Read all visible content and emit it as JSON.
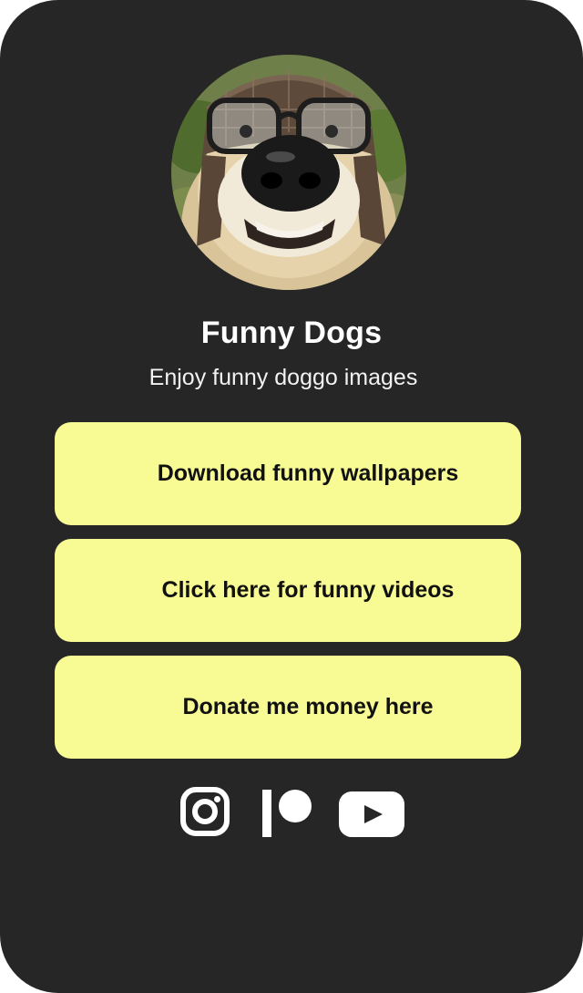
{
  "profile": {
    "name": "Funny Dogs",
    "tagline": "Enjoy funny doggo images",
    "avatar_icon": "dog-with-glasses-photo"
  },
  "links": [
    {
      "label": "Download funny wallpapers"
    },
    {
      "label": "Click here for funny videos"
    },
    {
      "label": "Donate me money here"
    }
  ],
  "socials": [
    {
      "icon": "instagram-icon"
    },
    {
      "icon": "patreon-icon"
    },
    {
      "icon": "youtube-icon"
    }
  ],
  "colors": {
    "background": "#262626",
    "button": "#f8fa94",
    "button_text": "#111111",
    "text": "#ffffff"
  }
}
